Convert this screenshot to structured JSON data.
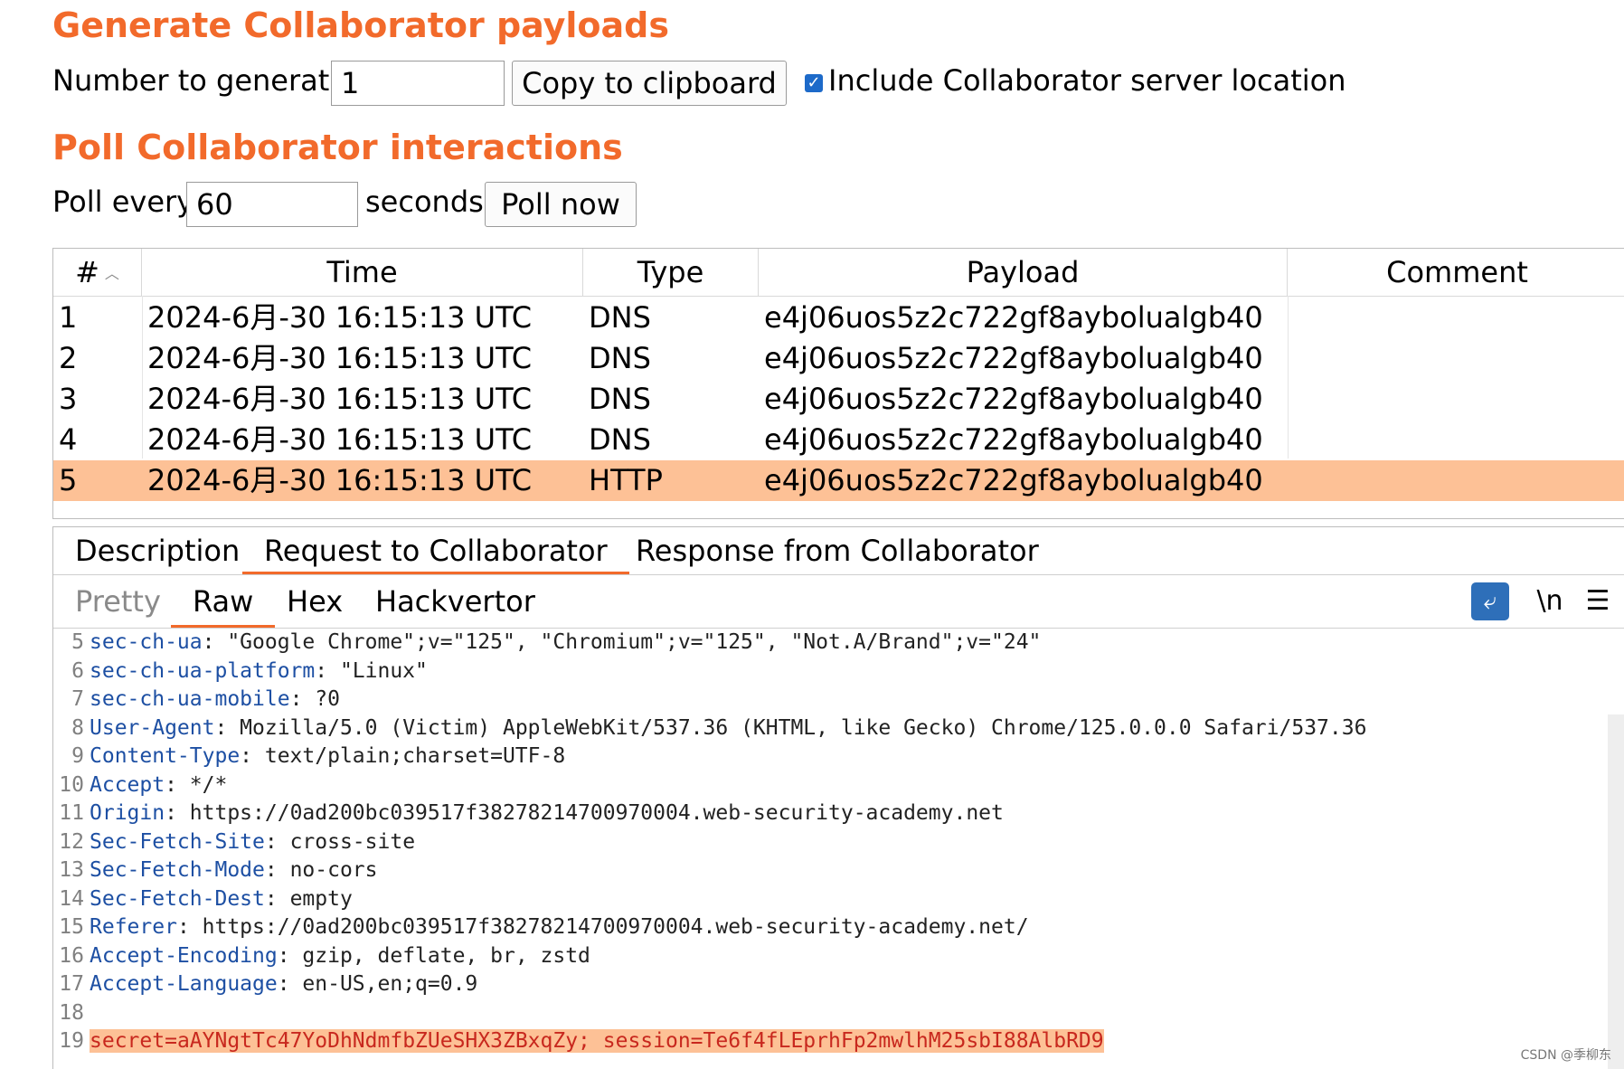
{
  "generate": {
    "title": "Generate Collaborator payloads",
    "number_label": "Number to generate:",
    "number_value": "1",
    "copy_button": "Copy to clipboard",
    "include_checkbox_checked": true,
    "include_label": "Include Collaborator server location"
  },
  "poll": {
    "title": "Poll Collaborator interactions",
    "poll_every_label": "Poll every",
    "poll_value": "60",
    "seconds_label": "seconds",
    "poll_now_button": "Poll now"
  },
  "table": {
    "columns": [
      "#",
      "Time",
      "Type",
      "Payload",
      "Comment"
    ],
    "sort_icon": "chevron-up-icon",
    "rows": [
      {
        "num": "1",
        "time": "2024-6月-30 16:15:13 UTC",
        "type": "DNS",
        "payload": "e4j06uos5z2c722gf8aybolualgb40",
        "comment": ""
      },
      {
        "num": "2",
        "time": "2024-6月-30 16:15:13 UTC",
        "type": "DNS",
        "payload": "e4j06uos5z2c722gf8aybolualgb40",
        "comment": ""
      },
      {
        "num": "3",
        "time": "2024-6月-30 16:15:13 UTC",
        "type": "DNS",
        "payload": "e4j06uos5z2c722gf8aybolualgb40",
        "comment": ""
      },
      {
        "num": "4",
        "time": "2024-6月-30 16:15:13 UTC",
        "type": "DNS",
        "payload": "e4j06uos5z2c722gf8aybolualgb40",
        "comment": ""
      },
      {
        "num": "5",
        "time": "2024-6月-30 16:15:13 UTC",
        "type": "HTTP",
        "payload": "e4j06uos5z2c722gf8aybolualgb40",
        "comment": ""
      }
    ],
    "selected_row": 5
  },
  "detail_tabs": [
    "Description",
    "Request to Collaborator",
    "Response from Collaborator"
  ],
  "active_detail_tab": "Request to Collaborator",
  "view_tabs": [
    "Pretty",
    "Raw",
    "Hex",
    "Hackvertor"
  ],
  "active_view_tab": "Raw",
  "tools": {
    "wrap_icon": "wrap-lines-icon",
    "newline_label": "\\n",
    "menu_icon": "hamburger-menu-icon"
  },
  "request_lines": [
    {
      "n": "5",
      "key": "sec-ch-ua",
      "value": ": \"Google Chrome\";v=\"125\", \"Chromium\";v=\"125\", \"Not.A/Brand\";v=\"24\""
    },
    {
      "n": "6",
      "key": "sec-ch-ua-platform",
      "value": ": \"Linux\""
    },
    {
      "n": "7",
      "key": "sec-ch-ua-mobile",
      "value": ": ?0"
    },
    {
      "n": "8",
      "key": "User-Agent",
      "value": ": Mozilla/5.0 (Victim) AppleWebKit/537.36 (KHTML, like Gecko) Chrome/125.0.0.0 Safari/537.36"
    },
    {
      "n": "9",
      "key": "Content-Type",
      "value": ": text/plain;charset=UTF-8"
    },
    {
      "n": "10",
      "key": "Accept",
      "value": ": */*"
    },
    {
      "n": "11",
      "key": "Origin",
      "value": ": https://0ad200bc039517f38278214700970004.web-security-academy.net"
    },
    {
      "n": "12",
      "key": "Sec-Fetch-Site",
      "value": ": cross-site"
    },
    {
      "n": "13",
      "key": "Sec-Fetch-Mode",
      "value": ": no-cors"
    },
    {
      "n": "14",
      "key": "Sec-Fetch-Dest",
      "value": ": empty"
    },
    {
      "n": "15",
      "key": "Referer",
      "value": ": https://0ad200bc039517f38278214700970004.web-security-academy.net/"
    },
    {
      "n": "16",
      "key": "Accept-Encoding",
      "value": ": gzip, deflate, br, zstd"
    },
    {
      "n": "17",
      "key": "Accept-Language",
      "value": ": en-US,en;q=0.9"
    },
    {
      "n": "18",
      "key": "",
      "value": ""
    },
    {
      "n": "19",
      "key": "secret",
      "value": "=aAYNgtTc47YoDhNdmfbZUeSHX3ZBxqZy; session=Te6f4fLEprhFp2mwlhM25sbI88AlbRD9",
      "highlight": true
    }
  ],
  "watermark": "CSDN @季柳东"
}
